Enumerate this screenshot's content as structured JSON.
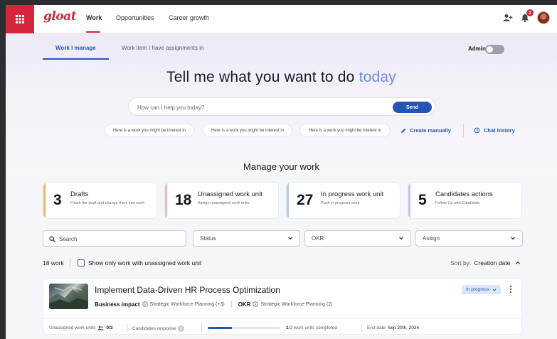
{
  "nav": {
    "logo": "gloat",
    "items": [
      "Work",
      "Opportunities",
      "Career growth"
    ],
    "notification_count": "1"
  },
  "subtabs": [
    "Work I manage",
    "Work item I have assignments in"
  ],
  "admin": {
    "label": "Admin",
    "enabled": false
  },
  "hero": {
    "headline_main": "Tell me what you want to do",
    "headline_highlight": "today",
    "prompt_placeholder": "How can I help you today?",
    "send_label": "Send",
    "chips": [
      "Here is a work you might be interest in",
      "Here is a work you might be interest in",
      "Here is a work you might be interest in"
    ],
    "create_manually": "Create manually",
    "chat_history": "Chat history"
  },
  "manage": {
    "title": "Manage your work",
    "cards": [
      {
        "num": "3",
        "title": "Drafts",
        "desc": "Finish the draft and change them into work",
        "accent": "#f2b66b"
      },
      {
        "num": "18",
        "title": "Unassigned work unit",
        "desc": "Assign unassigned work units",
        "accent": "#f1b8b8"
      },
      {
        "num": "27",
        "title": "In progress work unit",
        "desc": "Push in progress work",
        "accent": "#b8c9ef"
      },
      {
        "num": "5",
        "title": "Candidates actions",
        "desc": "Follow Up with Candidate",
        "accent": "#cdbdee"
      }
    ]
  },
  "filters": {
    "search_placeholder": "Search",
    "status": "Status",
    "okr": "OKR",
    "assign": "Assign"
  },
  "list": {
    "count": "18 work",
    "checkbox_label": "Show only work with unassigned work unit",
    "sort_label": "Sort by:",
    "sort_value": "Creation date"
  },
  "work_item": {
    "title": "Implement Data-Driven HR Process Optimization",
    "status": "In progress",
    "business_impact_label": "Business impact",
    "business_impact_value": "Strategic Workforce Planning (+3)",
    "okr_label": "OKR",
    "okr_value": "Strategic Workforce Planning (2)",
    "unassigned_label": "Unassigned work units",
    "unassigned_value": "0/3",
    "candidates_label": "Candidates response",
    "candidates_value": "0",
    "completed_value": "1",
    "completed_text": "/3 work units completed",
    "progress_fraction": 0.33,
    "end_date_label": "End date",
    "end_date_value": "Sep 20th, 2024"
  }
}
